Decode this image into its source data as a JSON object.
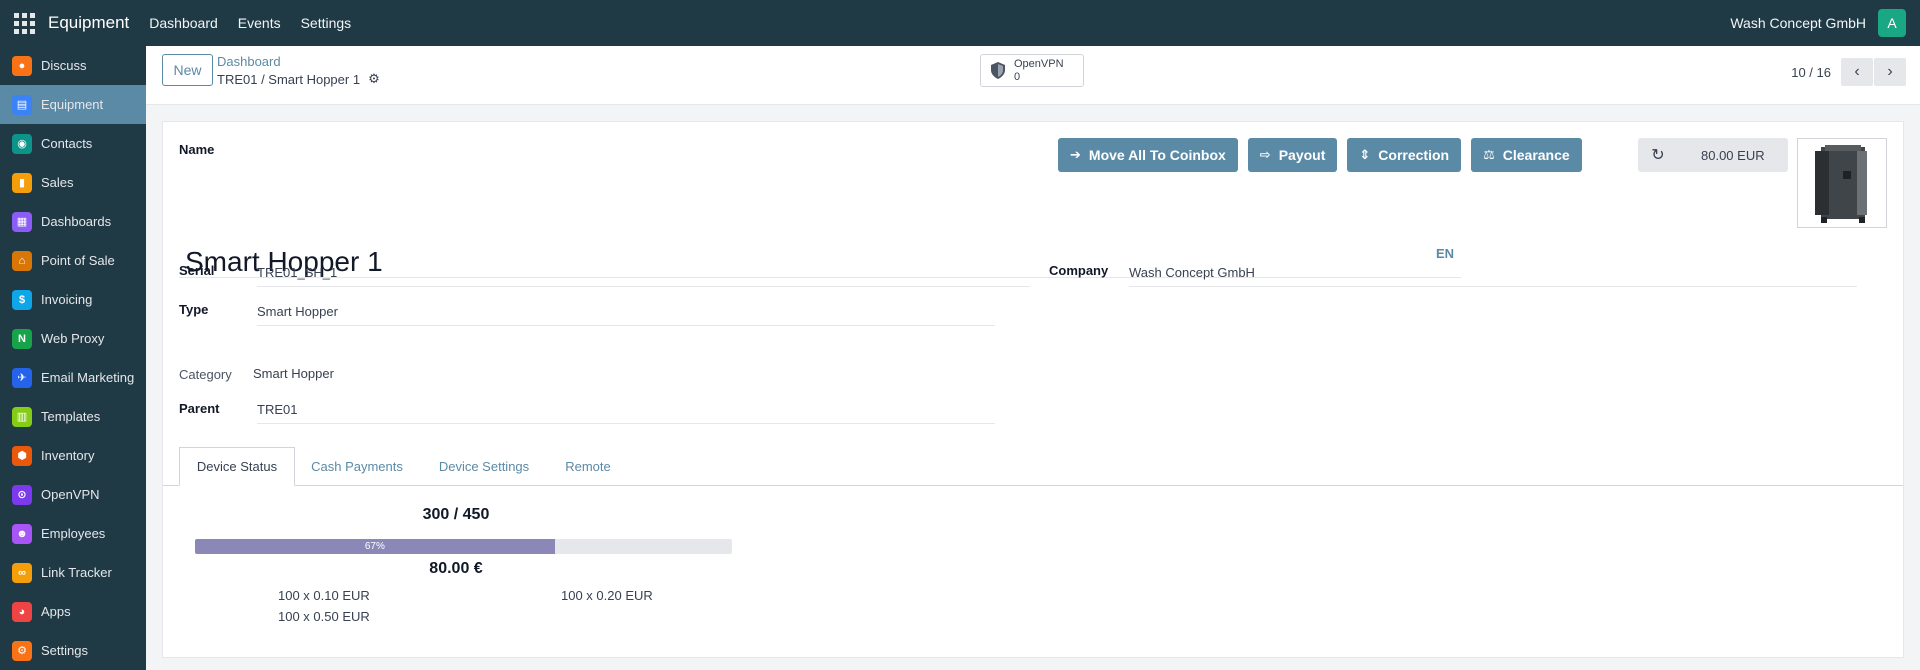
{
  "topbar": {
    "app_title": "Equipment",
    "menu": [
      "Dashboard",
      "Events",
      "Settings"
    ],
    "company": "Wash Concept GmbH",
    "avatar_letter": "A"
  },
  "sidebar": {
    "items": [
      {
        "label": "Discuss",
        "icon": "discuss-icon",
        "color": "#f97316"
      },
      {
        "label": "Equipment",
        "icon": "equipment-icon",
        "color": "#3b82f6",
        "active": true
      },
      {
        "label": "Contacts",
        "icon": "contacts-icon",
        "color": "#0d9488"
      },
      {
        "label": "Sales",
        "icon": "sales-icon",
        "color": "#f59e0b"
      },
      {
        "label": "Dashboards",
        "icon": "dashboards-icon",
        "color": "#8b5cf6"
      },
      {
        "label": "Point of Sale",
        "icon": "point-of-sale-icon",
        "color": "#d97706"
      },
      {
        "label": "Invoicing",
        "icon": "invoicing-icon",
        "color": "#0ea5e9"
      },
      {
        "label": "Web Proxy",
        "icon": "web-proxy-icon",
        "color": "#16a34a"
      },
      {
        "label": "Email Marketing",
        "icon": "email-marketing-icon",
        "color": "#2563eb"
      },
      {
        "label": "Templates",
        "icon": "templates-icon",
        "color": "#84cc16"
      },
      {
        "label": "Inventory",
        "icon": "inventory-icon",
        "color": "#ea580c"
      },
      {
        "label": "OpenVPN",
        "icon": "openvpn-icon",
        "color": "#7c3aed"
      },
      {
        "label": "Employees",
        "icon": "employees-icon",
        "color": "#a855f7"
      },
      {
        "label": "Link Tracker",
        "icon": "link-tracker-icon",
        "color": "#f59e0b"
      },
      {
        "label": "Apps",
        "icon": "apps-store-icon",
        "color": "#ef4444"
      },
      {
        "label": "Settings",
        "icon": "settings-icon",
        "color": "#f97316"
      }
    ]
  },
  "control": {
    "new_label": "New",
    "breadcrumb_parent": "Dashboard",
    "breadcrumb_current": "TRE01 / Smart Hopper 1",
    "vpn_label": "OpenVPN",
    "vpn_count": "0",
    "pager_value": "10 / 16"
  },
  "form": {
    "name_label": "Name",
    "buttons": {
      "move_all": "Move All To Coinbox",
      "payout": "Payout",
      "correction": "Correction",
      "clearance": "Clearance"
    },
    "balance": "80.00 EUR",
    "title": "Smart Hopper 1",
    "lang": "EN",
    "serial_label": "Serial",
    "serial_value": "TRE01_SH_1",
    "type_label": "Type",
    "type_value": "Smart Hopper",
    "category_label": "Category",
    "category_value": "Smart Hopper",
    "parent_label": "Parent",
    "parent_value": "TRE01",
    "company_label": "Company",
    "company_value": "Wash Concept GmbH"
  },
  "tabs": [
    "Device Status",
    "Cash Payments",
    "Device Settings",
    "Remote"
  ],
  "device_status": {
    "fill_count": "300 / 450",
    "progress_percent": 67,
    "progress_label": "67%",
    "amount": "80.00 €",
    "coins": [
      "100 x 0.10 EUR",
      "100 x 0.20 EUR",
      "100 x 0.50 EUR"
    ]
  }
}
